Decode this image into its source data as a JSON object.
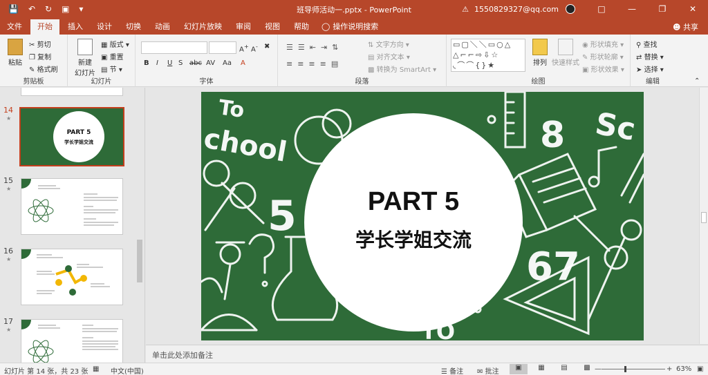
{
  "titlebar": {
    "title": "班导师活动一.pptx  -  PowerPoint",
    "account": "1550829327@qq.com",
    "icons": [
      "save-icon",
      "undo-icon",
      "redo-icon",
      "slideshow-icon",
      "customize-icon"
    ]
  },
  "tabs": [
    "文件",
    "开始",
    "插入",
    "设计",
    "切换",
    "动画",
    "幻灯片放映",
    "审阅",
    "视图",
    "帮助"
  ],
  "tab_active": "开始",
  "search_label": "操作说明搜索",
  "share_label": "共享",
  "ribbon": {
    "clipboard": {
      "paste": "粘贴",
      "cut": "剪切",
      "copy": "复制",
      "format_painter": "格式刷",
      "label": "剪贴板"
    },
    "slides": {
      "new_slide_1": "新建",
      "new_slide_2": "幻灯片",
      "layout": "版式",
      "reset": "重置",
      "section": "节",
      "label": "幻灯片"
    },
    "font": {
      "bold": "B",
      "italic": "I",
      "underline": "U",
      "strike": "S",
      "spacing": "abc",
      "char_spacing": "AV",
      "case": "Aa",
      "label": "字体"
    },
    "paragraph": {
      "text_direction": "文字方向",
      "align_text": "对齐文本",
      "convert_smartart": "转换为 SmartArt",
      "label": "段落"
    },
    "drawing": {
      "arrange": "排列",
      "quick_styles": "快速样式",
      "shape_fill": "形状填充",
      "shape_outline": "形状轮廓",
      "shape_effects": "形状效果",
      "label": "绘图"
    },
    "editing": {
      "find": "查找",
      "replace": "替换",
      "select": "选择",
      "label": "编辑"
    }
  },
  "thumbnails": [
    {
      "num": "14",
      "title": "PART 5",
      "subtitle": "学长学姐交流",
      "selected": true
    },
    {
      "num": "15",
      "selected": false
    },
    {
      "num": "16",
      "selected": false
    },
    {
      "num": "17",
      "selected": false
    }
  ],
  "slide": {
    "title": "PART 5",
    "subtitle": "学长学姐交流",
    "bg_color": "#2e6b38",
    "bg_texts": [
      "To",
      "chool",
      "8",
      "Sc",
      "5",
      "67",
      "TO"
    ]
  },
  "notes_placeholder": "单击此处添加备注",
  "status": {
    "slide_info": "幻灯片 第 14 张，共 23 张",
    "language": "中文(中国)",
    "notes_btn": "备注",
    "comments_btn": "批注",
    "zoom": "63%"
  },
  "colors": {
    "accent": "#b7472a",
    "selection": "#c43e1c"
  }
}
